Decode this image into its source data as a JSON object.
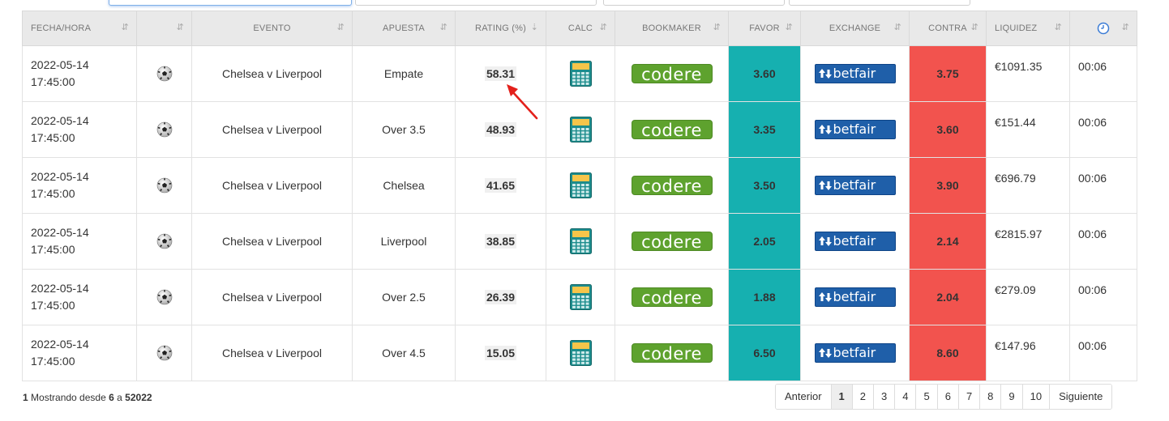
{
  "columns": [
    {
      "label": "FECHA/HORA",
      "sort": "⇵"
    },
    {
      "label": "",
      "sort": "⇵"
    },
    {
      "label": "EVENTO",
      "sort": "⇵"
    },
    {
      "label": "APUESTA",
      "sort": "⇵"
    },
    {
      "label": "RATING (%)",
      "sort": "⇣"
    },
    {
      "label": "CALC",
      "sort": "⇵"
    },
    {
      "label": "BOOKMAKER",
      "sort": "⇵"
    },
    {
      "label": "FAVOR",
      "sort": "⇵"
    },
    {
      "label": "EXCHANGE",
      "sort": "⇵"
    },
    {
      "label": "CONTRA",
      "sort": "⇵"
    },
    {
      "label": "LIQUIDEZ",
      "sort": "⇵"
    },
    {
      "label": "",
      "sort": "⇵",
      "icon": "clock-icon"
    }
  ],
  "bookmaker_logo": "codere",
  "exchange_logo": "betfair",
  "colors": {
    "favor": "#16b0b0",
    "contra": "#f2534e",
    "codere": "#5ea22e",
    "betfair": "#1f5fa9"
  },
  "rows": [
    {
      "date": "2022-05-14",
      "time": "17:45:00",
      "sport_icon": "soccer-ball-icon",
      "event": "Chelsea v Liverpool",
      "bet": "Empate",
      "rating": "58.31",
      "favor": "3.60",
      "contra": "3.75",
      "liquidity": "€1091.35",
      "age": "00:06"
    },
    {
      "date": "2022-05-14",
      "time": "17:45:00",
      "sport_icon": "soccer-ball-icon",
      "event": "Chelsea v Liverpool",
      "bet": "Over 3.5",
      "rating": "48.93",
      "favor": "3.35",
      "contra": "3.60",
      "liquidity": "€151.44",
      "age": "00:06"
    },
    {
      "date": "2022-05-14",
      "time": "17:45:00",
      "sport_icon": "soccer-ball-icon",
      "event": "Chelsea v Liverpool",
      "bet": "Chelsea",
      "rating": "41.65",
      "favor": "3.50",
      "contra": "3.90",
      "liquidity": "€696.79",
      "age": "00:06"
    },
    {
      "date": "2022-05-14",
      "time": "17:45:00",
      "sport_icon": "soccer-ball-icon",
      "event": "Chelsea v Liverpool",
      "bet": "Liverpool",
      "rating": "38.85",
      "favor": "2.05",
      "contra": "2.14",
      "liquidity": "€2815.97",
      "age": "00:06"
    },
    {
      "date": "2022-05-14",
      "time": "17:45:00",
      "sport_icon": "soccer-ball-icon",
      "event": "Chelsea v Liverpool",
      "bet": "Over 2.5",
      "rating": "26.39",
      "favor": "1.88",
      "contra": "2.04",
      "liquidity": "€279.09",
      "age": "00:06"
    },
    {
      "date": "2022-05-14",
      "time": "17:45:00",
      "sport_icon": "soccer-ball-icon",
      "event": "Chelsea v Liverpool",
      "bet": "Over 4.5",
      "rating": "15.05",
      "favor": "6.50",
      "contra": "8.60",
      "liquidity": "€147.96",
      "age": "00:06"
    }
  ],
  "footer": {
    "page": "1",
    "text_showing": "Mostrando desde",
    "from": "6",
    "text_to": "a",
    "total": "52022"
  },
  "pagination": {
    "prev": "Anterior",
    "pages": [
      "1",
      "2",
      "3",
      "4",
      "5",
      "6",
      "7",
      "8",
      "9",
      "10"
    ],
    "current": "1",
    "next": "Siguiente"
  }
}
